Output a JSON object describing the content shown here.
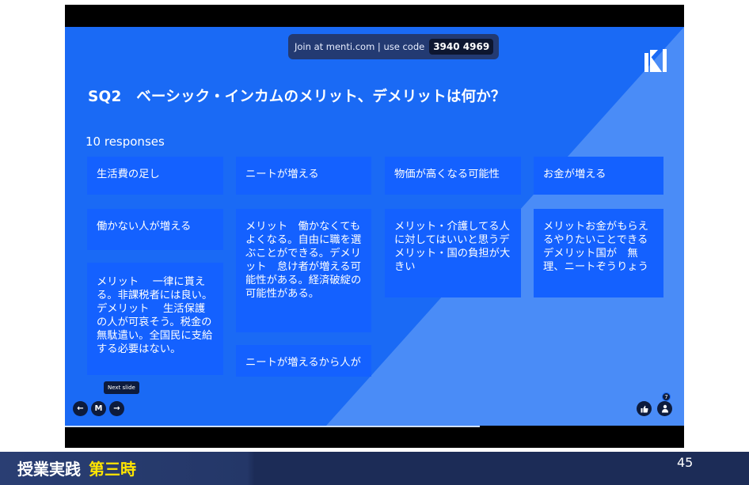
{
  "join": {
    "text": "Join at menti.com | use code",
    "code": "3940 4969"
  },
  "question": "SQ2　ベーシック・インカムのメリット、デメリットは何か？",
  "response_count": "10 responses",
  "responses": [
    "生活費の足し",
    "働かない人が増える",
    "メリット　 一律に貰える。非課税者には良い。デメリット　 生活保護の人が可哀そう。税金の無駄遣い。全国民に支給する必要はない。",
    "ニートが増える",
    "メリット　働かなくてもよくなる。自由に職を選ぶことができる。デメリット　怠け者が増える可能性がある。経済破綻の可能性がある。",
    "ニートが増えるから人が",
    "物価が高くなる可能性",
    "メリット・介護してる人に対してはいいと思うデメリット・国の負担が大きい",
    "お金が増える",
    "メリットお金がもらえるやりたいことできるデメリット国が　無理、ニートぞうりょう"
  ],
  "controls": {
    "tooltip": "Next slide",
    "prev": "←",
    "menu": "M",
    "next": "→",
    "audience_count": "7"
  },
  "footer": {
    "title": "授業実践",
    "accent": "第三時",
    "page": "45"
  },
  "colors": {
    "slide_bg": "#1a6af5",
    "card_bg": "#1461ff",
    "footer_accent": "#ffe500"
  },
  "progress": 0.67
}
